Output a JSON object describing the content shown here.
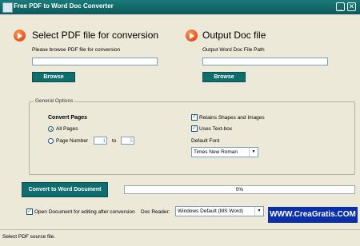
{
  "window": {
    "title": "Free PDF to Word Doc Converter"
  },
  "input_section": {
    "heading": "Select PDF file for conversion",
    "prompt": "Please browse PDF file for conversion",
    "path_value": "",
    "browse_label": "Browse"
  },
  "output_section": {
    "heading": "Output Doc file",
    "prompt": "Output Word Doc File Path",
    "path_value": "",
    "browse_label": "Browse"
  },
  "general_options": {
    "legend": "General Options",
    "convert_pages_title": "Convert Pages",
    "all_pages_label": "All Pages",
    "page_number_label": "Page Number",
    "page_from": "1",
    "to_label": "to",
    "page_to": "5",
    "retain_shapes_label": "Retains Shapes and Images",
    "retain_shapes_checked": true,
    "uses_textbox_label": "Uses Text-box",
    "uses_textbox_checked": true,
    "default_font_label": "Default Font",
    "default_font_value": "Times New Roman"
  },
  "convert": {
    "button_label": "Convert to Word Document",
    "progress_text": "0%",
    "progress_fraction": 0
  },
  "options_row": {
    "open_after_label": "Open Document for editing after conversion",
    "open_after_checked": true,
    "doc_reader_label": "Doc Reader:",
    "doc_reader_value": "Windows Default (MS Word)"
  },
  "status": {
    "text": "Select PDF source file."
  },
  "watermark": {
    "text": "WWW.CreaGratis.COM"
  },
  "icons": {
    "section_icon": "orange-arrow-icon",
    "check": "check-icon"
  },
  "colors": {
    "titlebar": "#0c5a5a",
    "button": "#0f6d6d",
    "accent_orange": "#e0501a",
    "watermark_bg": "#0a2fa8"
  }
}
